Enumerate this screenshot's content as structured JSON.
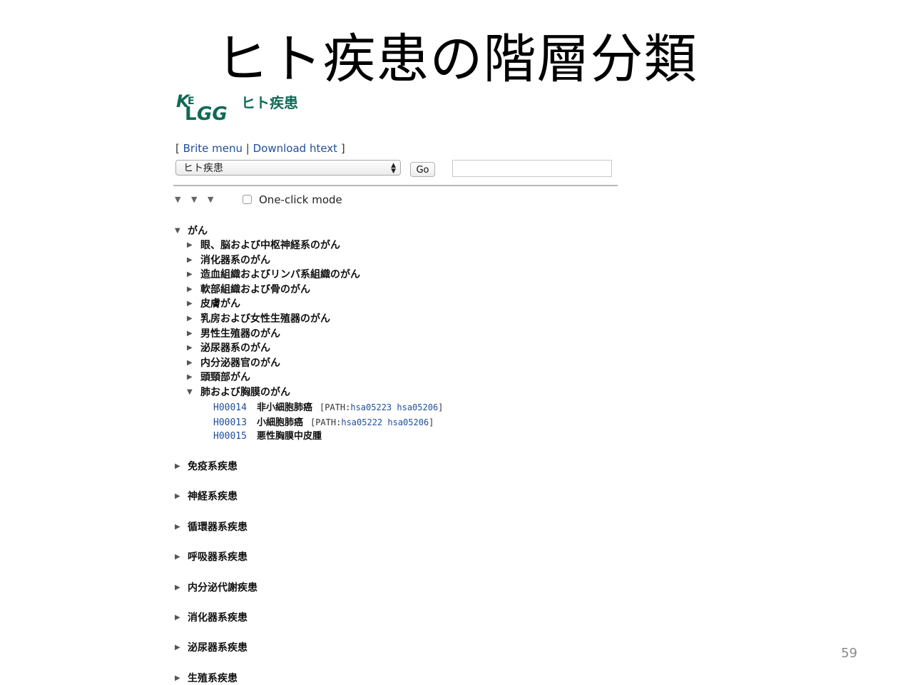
{
  "slide": {
    "title": "ヒト疾患の階層分類",
    "page_number": "59"
  },
  "kegg": {
    "logo_text": "KEGG",
    "page_title": "ヒト疾患",
    "links": {
      "open": "[",
      "brite_menu": "Brite menu",
      "sep": "|",
      "download_htext": "Download htext",
      "close": "]"
    },
    "select_value": "ヒト疾患",
    "go_label": "Go",
    "search_value": "",
    "oneclick_label": "One-click mode",
    "level_toggles": [
      "▼",
      "▼",
      "▼"
    ]
  },
  "tree": {
    "cancer": {
      "label": "がん",
      "expanded": true,
      "children": [
        {
          "label": "眼、脳および中枢神経系のがん",
          "expanded": false
        },
        {
          "label": "消化器系のがん",
          "expanded": false
        },
        {
          "label": "造血組織およびリンパ系組織のがん",
          "expanded": false
        },
        {
          "label": "軟部組織および骨のがん",
          "expanded": false
        },
        {
          "label": "皮膚がん",
          "expanded": false
        },
        {
          "label": "乳房および女性生殖器のがん",
          "expanded": false
        },
        {
          "label": "男性生殖器のがん",
          "expanded": false
        },
        {
          "label": "泌尿器系のがん",
          "expanded": false
        },
        {
          "label": "内分泌器官のがん",
          "expanded": false
        },
        {
          "label": "頭頸部がん",
          "expanded": false
        },
        {
          "label": "肺および胸膜のがん",
          "expanded": true
        }
      ],
      "leaves": [
        {
          "code": "H00014",
          "name": "非小細胞肺癌",
          "path_open": "[PATH:",
          "paths": [
            "hsa05223",
            "hsa05206"
          ],
          "path_close": "]"
        },
        {
          "code": "H00013",
          "name": "小細胞肺癌",
          "path_open": "[PATH:",
          "paths": [
            "hsa05222",
            "hsa05206"
          ],
          "path_close": "]"
        },
        {
          "code": "H00015",
          "name": "悪性胸膜中皮腫"
        }
      ]
    },
    "other_categories": [
      {
        "label": "免疫系疾患",
        "expanded": false
      },
      {
        "label": "神経系疾患",
        "expanded": false
      },
      {
        "label": "循環器系疾患",
        "expanded": false
      },
      {
        "label": "呼吸器系疾患",
        "expanded": false
      },
      {
        "label": "内分泌代謝疾患",
        "expanded": false
      },
      {
        "label": "消化器系疾患",
        "expanded": false
      },
      {
        "label": "泌尿器系疾患",
        "expanded": false
      },
      {
        "label": "生殖系疾患",
        "expanded": false
      }
    ]
  },
  "colors": {
    "link": "#1f4e9a",
    "kegg_green": "#116c57",
    "kegg_text_green": "#0f6a55"
  }
}
